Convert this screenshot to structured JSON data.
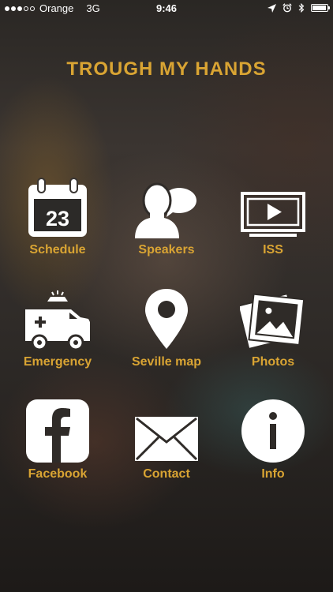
{
  "status_bar": {
    "carrier": "Orange",
    "network": "3G",
    "time": "9:46",
    "signal_filled": 3,
    "signal_total": 5,
    "battery_level_percent": 95
  },
  "header": {
    "title": "TROUGH MY HANDS"
  },
  "theme": {
    "accent_color": "#d9a433",
    "icon_color": "#ffffff"
  },
  "calendar": {
    "day": "23"
  },
  "menu": [
    {
      "label": "Schedule",
      "icon": "calendar-icon"
    },
    {
      "label": "Speakers",
      "icon": "speakers-icon"
    },
    {
      "label": "ISS",
      "icon": "video-player-icon"
    },
    {
      "label": "Emergency",
      "icon": "ambulance-icon"
    },
    {
      "label": "Seville map",
      "icon": "map-pin-icon"
    },
    {
      "label": "Photos",
      "icon": "photos-icon"
    },
    {
      "label": "Facebook",
      "icon": "facebook-icon"
    },
    {
      "label": "Contact",
      "icon": "envelope-icon"
    },
    {
      "label": "Info",
      "icon": "info-icon"
    }
  ]
}
